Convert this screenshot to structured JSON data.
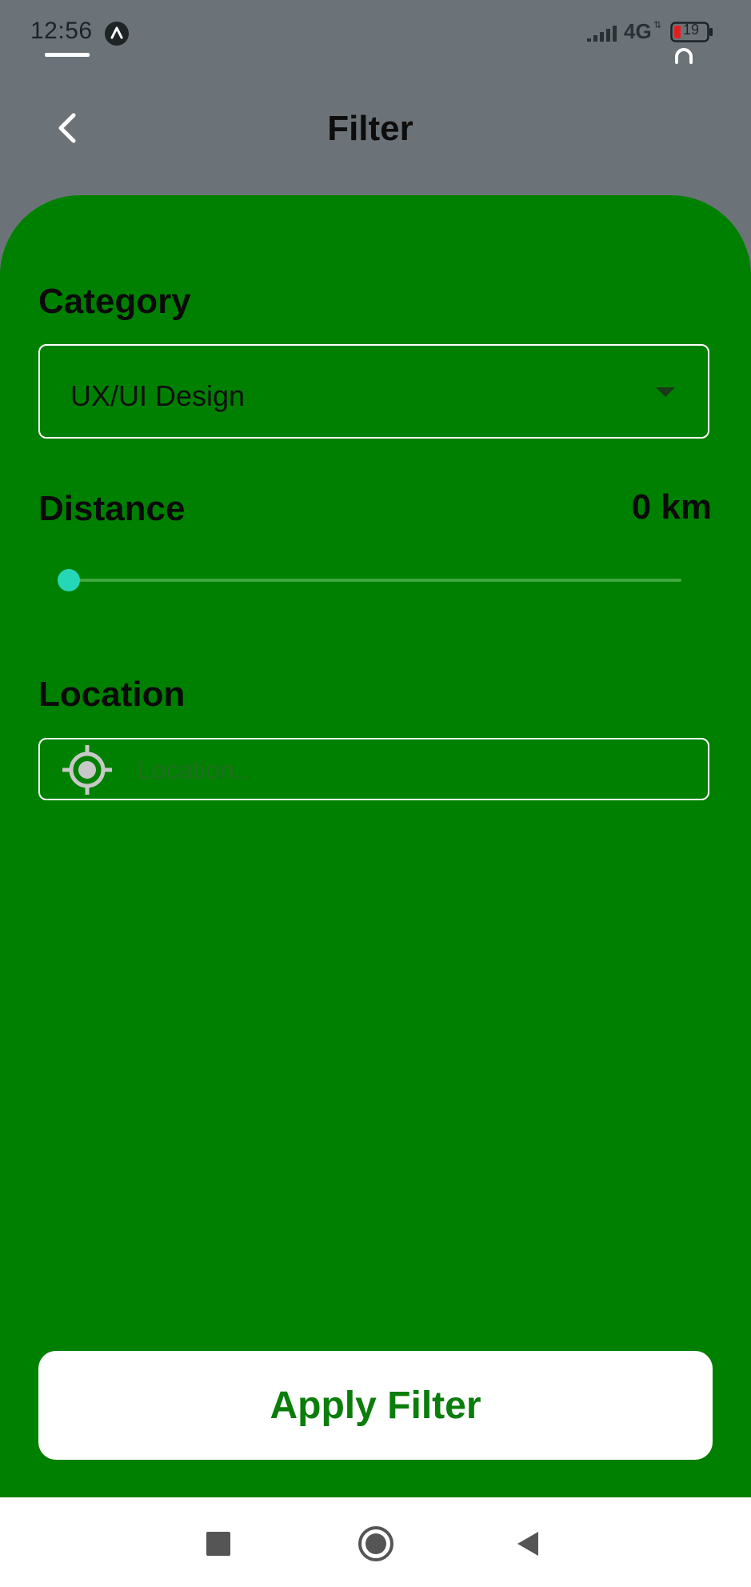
{
  "status_bar": {
    "time": "12:56",
    "network": "4G",
    "battery": "19"
  },
  "header": {
    "title": "Filter",
    "back_icon": "chevron-left-icon"
  },
  "filters": {
    "category": {
      "label": "Category",
      "value": "UX/UI Design"
    },
    "distance": {
      "label": "Distance",
      "value_text": "0 km",
      "value": 0
    },
    "location": {
      "label": "Location",
      "placeholder": "Location..",
      "value": "",
      "icon": "gps-target-icon"
    }
  },
  "actions": {
    "apply_label": "Apply Filter"
  },
  "colors": {
    "panel": "#008000",
    "header_bg": "#6b7378",
    "slider_thumb": "#26d7b7",
    "apply_text": "#0a7d0a"
  }
}
